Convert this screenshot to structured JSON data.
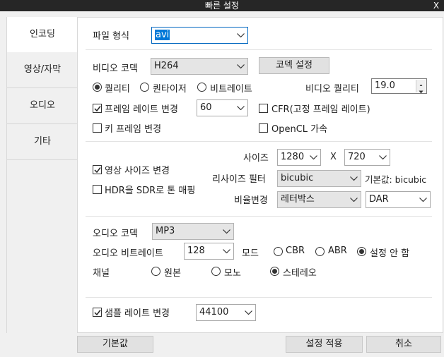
{
  "window": {
    "title": "빠른 설정",
    "close": "X"
  },
  "sidebar": {
    "tabs": [
      "인코딩",
      "영상/자막",
      "오디오",
      "기타"
    ]
  },
  "format": {
    "label": "파일 형식",
    "value": "avi"
  },
  "video": {
    "codec_label": "비디오 코덱",
    "codec_value": "H264",
    "codec_settings": "코덱 설정",
    "mode_options": [
      "퀄리티",
      "퀀타이저",
      "비트레이트"
    ],
    "mode_selected": "퀄리티",
    "quality_label": "비디오 퀄리티",
    "quality_value": "19.0",
    "framerate_label": "프레임 레이트 변경",
    "framerate_checked": true,
    "framerate_value": "60",
    "cfr_label": "CFR(고정 프레임 레이트)",
    "cfr_checked": false,
    "keyframe_label": "키 프레임 변경",
    "keyframe_checked": false,
    "opencl_label": "OpenCL 가속",
    "opencl_checked": false
  },
  "resize": {
    "change_label": "영상 사이즈 변경",
    "change_checked": true,
    "hdr_label": "HDR을 SDR로 톤 매핑",
    "hdr_checked": false,
    "size_label": "사이즈",
    "width": "1280",
    "x": "X",
    "height": "720",
    "filter_label": "리사이즈 필터",
    "filter_value": "bicubic",
    "default_note": "기본값: bicubic",
    "ratio_label": "비율변경",
    "ratio_value": "레터박스",
    "ratio_type": "DAR"
  },
  "audio": {
    "codec_label": "오디오 코덱",
    "codec_value": "MP3",
    "bitrate_label": "오디오 비트레이트",
    "bitrate_value": "128",
    "mode_label": "모드",
    "mode_options": [
      "CBR",
      "ABR",
      "설정 안 함"
    ],
    "mode_selected": "설정 안 함",
    "channel_label": "채널",
    "channel_options": [
      "원본",
      "모노",
      "스테레오"
    ],
    "channel_selected": "스테레오",
    "samplerate_label": "샘플 레이트 변경",
    "samplerate_checked": true,
    "samplerate_value": "44100"
  },
  "footer": {
    "default": "기본값",
    "apply": "설정 적용",
    "cancel": "취소"
  },
  "colors": {
    "accent": "#0078d7",
    "titlebar": "#262626",
    "panel": "#ffffff",
    "window": "#f0f0f0"
  }
}
